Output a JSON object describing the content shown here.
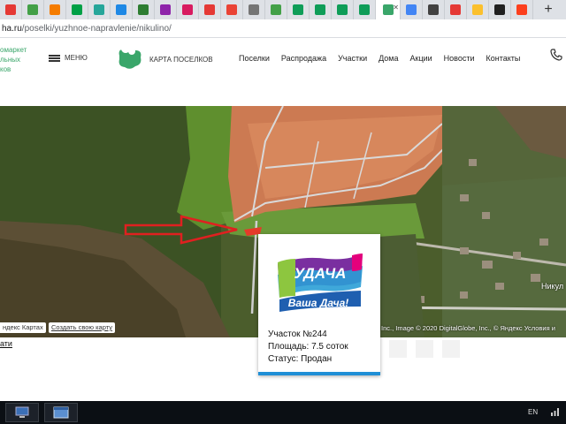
{
  "browser": {
    "tabs": [
      {
        "icon": "gb-icon",
        "color": "#e53935"
      },
      {
        "icon": "check-icon",
        "color": "#43a047"
      },
      {
        "icon": "dns-icon",
        "color": "#f57c00"
      },
      {
        "icon": "avito-icon",
        "color": "#00a046"
      },
      {
        "icon": "triangle-icon",
        "color": "#26a69a"
      },
      {
        "icon": "circle-icon",
        "color": "#1e88e5"
      },
      {
        "icon": "t-icon",
        "color": "#2e7d32"
      },
      {
        "icon": "w-icon",
        "color": "#8e24aa"
      },
      {
        "icon": "play-icon",
        "color": "#d81b60"
      },
      {
        "icon": "maps-pin-icon",
        "color": "#e53935"
      },
      {
        "icon": "mail-icon",
        "color": "#ea4335"
      },
      {
        "icon": "home-icon",
        "color": "#757575"
      },
      {
        "icon": "house-icon",
        "color": "#43a047"
      },
      {
        "icon": "sheets-icon",
        "color": "#0f9d58"
      },
      {
        "icon": "sheets-icon",
        "color": "#0f9d58"
      },
      {
        "icon": "sheets-icon",
        "color": "#0f9d58"
      },
      {
        "icon": "sheets-icon",
        "color": "#0f9d58"
      },
      {
        "icon": "active-tab-icon",
        "color": "#3aa66a"
      },
      {
        "icon": "mosaic-icon",
        "color": "#4285f4"
      },
      {
        "icon": "sh-icon",
        "color": "#424242"
      },
      {
        "icon": "ball-icon",
        "color": "#e53935"
      },
      {
        "icon": "envelope-icon",
        "color": "#fbc02d"
      },
      {
        "icon": "plus-circle-icon",
        "color": "#212121"
      },
      {
        "icon": "yandex-icon",
        "color": "#fc3f1d"
      }
    ],
    "url_host": "ha.ru",
    "url_path": "/poselki/yuzhnoe-napravlenie/nikulino/"
  },
  "header": {
    "tagline": [
      "омаркет",
      "льных",
      "ков"
    ],
    "menu_label": "МЕНЮ",
    "logo_text": "КАРТА ПОСЕЛКОВ",
    "nav": [
      "Поселки",
      "Распродажа",
      "Участки",
      "Дома",
      "Акции",
      "Новости",
      "Контакты"
    ]
  },
  "map": {
    "copyright": "Inc., Image © 2020 DigitalGlobe, Inc., © Яндекс Условия и",
    "village_label": "Никул",
    "yandex_maps": "ндекс Картах",
    "create_map": "Создать свою карту",
    "below_link": "ати"
  },
  "popup": {
    "logo_top": "УДАЧА",
    "logo_bottom": "Ваша Дача!",
    "plot": "Участок №244",
    "area": "Площадь: 7.5 соток",
    "status": "Статус: Продан"
  },
  "taskbar": {
    "lang": "EN"
  },
  "colors": {
    "accent": "#3aa66a",
    "arrow": "#e02020",
    "popup_bar": "#1f8fd6",
    "plots": "#d97b4f"
  }
}
